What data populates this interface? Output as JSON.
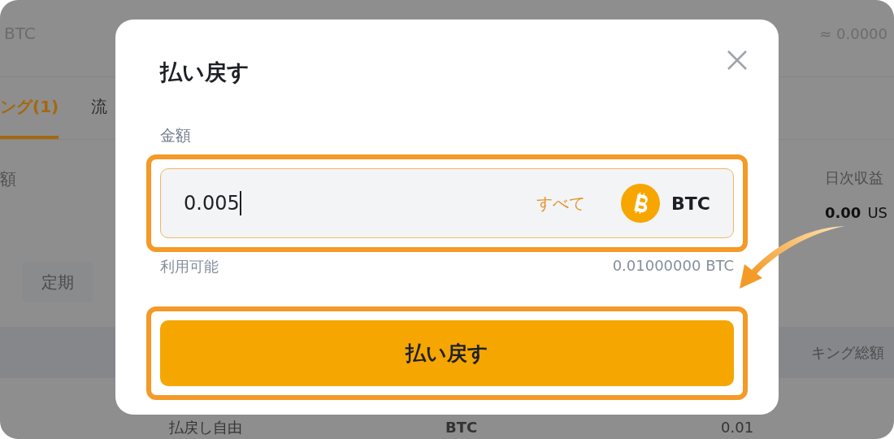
{
  "background": {
    "balance_left": "BTC",
    "balance_right": "≈ 0.0000",
    "tabs": [
      {
        "label": "ング(1)",
        "selected": true
      },
      {
        "label": "流",
        "selected": false
      }
    ],
    "left_label": "額",
    "daily_earnings": {
      "label": "日次収益",
      "value": "0.00",
      "unit": "US"
    },
    "filter_button": "定期",
    "table": {
      "column_header": "キング総額",
      "row": [
        "払戻し自由",
        "BTC",
        "0.01"
      ]
    }
  },
  "dialog": {
    "title": "払い戻す",
    "amount_label": "金額",
    "amount_value": "0.005",
    "max_link": "すべて",
    "currency": "BTC",
    "available_label": "利用可能",
    "available_value": "0.01000000 BTC",
    "submit": "払い戻す"
  }
}
